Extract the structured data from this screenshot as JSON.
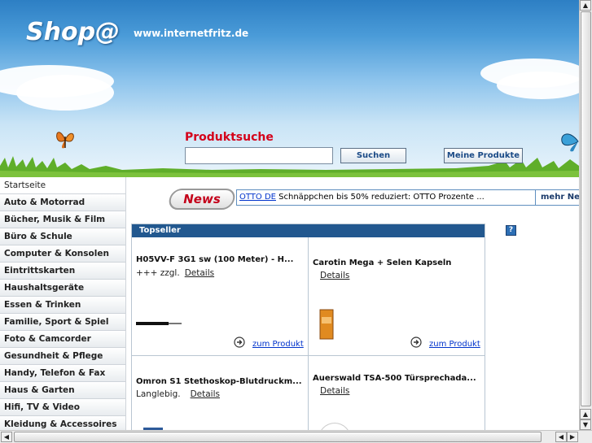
{
  "header": {
    "logo": "Shop@",
    "domain": "www.internetfritz.de",
    "search_title": "Produktsuche",
    "search_value": "",
    "search_button": "Suchen",
    "my_products_button": "Meine Produkte"
  },
  "sidebar": {
    "items": [
      {
        "label": "Startseite"
      },
      {
        "label": "Auto & Motorrad"
      },
      {
        "label": "Bücher, Musik & Film"
      },
      {
        "label": "Büro & Schule"
      },
      {
        "label": "Computer & Konsolen"
      },
      {
        "label": "Eintrittskarten"
      },
      {
        "label": "Haushaltsgeräte"
      },
      {
        "label": "Essen & Trinken"
      },
      {
        "label": "Familie, Sport & Spiel"
      },
      {
        "label": "Foto & Camcorder"
      },
      {
        "label": "Gesundheit & Pflege"
      },
      {
        "label": "Handy, Telefon & Fax"
      },
      {
        "label": "Haus & Garten"
      },
      {
        "label": "Hifi, TV & Video"
      },
      {
        "label": "Kleidung & Accessoires"
      }
    ]
  },
  "news": {
    "badge": "News",
    "link": "OTTO DE",
    "text": " Schnäppchen bis 50% reduziert: OTTO Prozente ...",
    "more": "mehr News"
  },
  "topseller": {
    "title": "Topseller",
    "help": "?",
    "products": [
      {
        "title": "H05VV-F 3G1 sw (100 Meter) - H...",
        "sub": "+++ zzgl.",
        "details": "Details",
        "link": "zum Produkt"
      },
      {
        "title": "Carotin Mega + Selen Kapseln",
        "sub": "",
        "details": "Details",
        "link": "zum Produkt"
      },
      {
        "title": "Omron S1 Stethoskop-Blutdruckm...",
        "sub": "Langlebig.",
        "details": "Details",
        "link": ""
      },
      {
        "title": "Auerswald TSA-500 Türsprechada...",
        "sub": "",
        "details": "Details",
        "link": ""
      }
    ]
  },
  "icons": {
    "arrow": "circle-arrow-right-icon",
    "scroll_up": "▲",
    "scroll_down": "▼",
    "scroll_left": "◀",
    "scroll_right": "▶"
  },
  "colors": {
    "accent_red": "#d4001a",
    "topseller_header": "#22588f",
    "link_blue": "#0033cc"
  }
}
